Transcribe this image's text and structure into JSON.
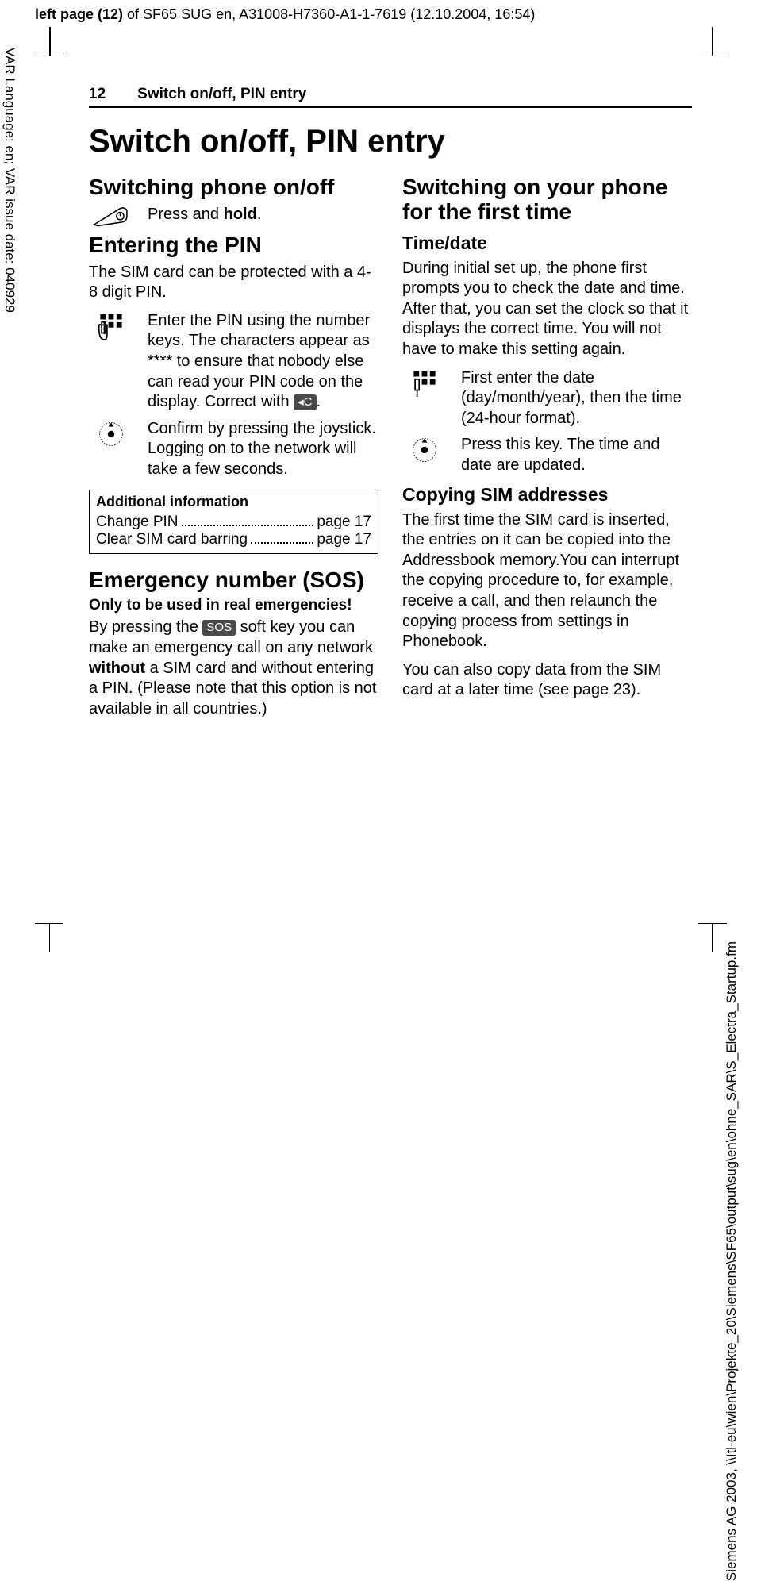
{
  "meta": {
    "top_header_prefix": "left page (12)",
    "top_header_rest": " of SF65 SUG en, A31008-H7360-A1-1-7619 (12.10.2004, 16:54)",
    "left_rail": "VAR Language: en; VAR issue date: 040929",
    "right_rail": "Siemens AG 2003, \\\\Itl-eu\\wien\\Projekte_20\\Siemens\\SF65\\output\\sug\\en\\ohne_SAR\\S_Electra_Startup.fm"
  },
  "running_head": {
    "page_number": "12",
    "title": "Switch on/off, PIN entry"
  },
  "page_title": "Switch on/off, PIN entry",
  "left_col": {
    "on_off": {
      "heading": "Switching phone on/off",
      "press_hold_pre": "Press and ",
      "press_hold_bold": "hold",
      "press_hold_post": "."
    },
    "pin": {
      "heading": "Entering the PIN",
      "intro": "The SIM card can be protected with a 4-8 digit PIN.",
      "step1_pre": "Enter the PIN using the number keys. The charac­ters appear as ",
      "step1_mask": "****",
      "step1_mid": " to en­sure that nobody else can read your PIN code on the display. Correct with ",
      "step1_key": "C",
      "step1_post": ".",
      "step2": "Confirm by pressing the joystick. Logging on to the network will take a few seconds."
    },
    "info": {
      "title": "Additional information",
      "rows": [
        {
          "label": "Change PIN",
          "page": "page 17"
        },
        {
          "label": "Clear SIM card barring",
          "page": "page 17"
        }
      ]
    },
    "sos": {
      "heading": "Emergency number (SOS)",
      "warn": "Only to be used in real emergencies!",
      "body_pre": "By pressing the ",
      "body_key": "SOS",
      "body_mid": " soft key you can make an emergency call on any net­work ",
      "body_bold": "without",
      "body_post": " a SIM card and without entering a PIN. (Please note that this option is not available in all countries.)"
    }
  },
  "right_col": {
    "first_time": {
      "heading": "Switching on your phone for the first time",
      "time_heading": "Time/date",
      "time_body": "During initial set up, the phone first prompts you to check the date and time. After that, you can set the clock so that it displays the correct time. You will not have to make this setting again.",
      "step1": "First enter the date (day/month/year), then the time (24-hour format).",
      "step2": "Press this key. The time and date are updated.",
      "sim_heading": "Copying SIM addresses",
      "sim_body1": "The first time the SIM card is insert­ed, the entries on it can be copied into the Addressbook memory.You can interrupt the copying procedure to, for example, receive a call, and then relaunch the copying process from settings in Phonebook.",
      "sim_body2": "You can also copy data from the SIM card at a later time (see page 23)."
    }
  }
}
